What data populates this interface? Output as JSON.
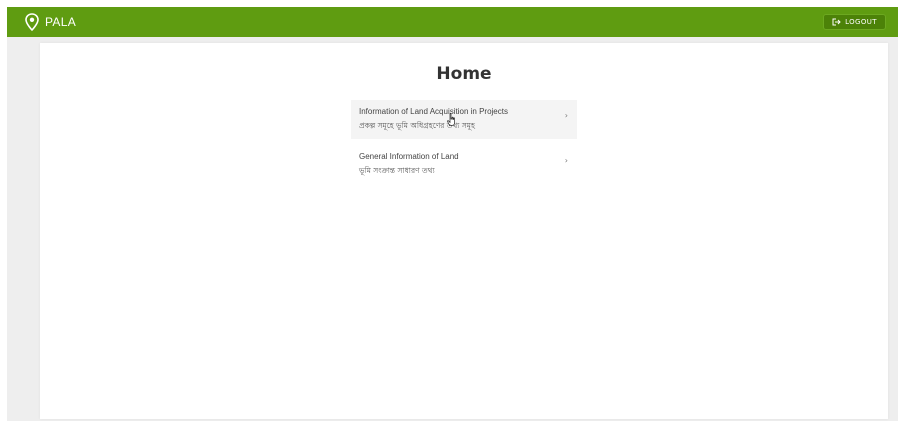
{
  "app": {
    "name": "PALA"
  },
  "header": {
    "logout_label": "LOGOUT"
  },
  "main": {
    "title": "Home",
    "items": [
      {
        "label_en": "Information of Land Acquisition in Projects",
        "label_bn": "প্রকল্প সমূহে ভূমি অধিগ্রহণের তথ্য সমূহ",
        "chevron": "›"
      },
      {
        "label_en": "General Information of Land",
        "label_bn": "ভূমি সংক্রান্ত সাধারণ তথ্য",
        "chevron": "›"
      }
    ]
  },
  "colors": {
    "topbar": "#5f9c11",
    "logout_button": "#4c8208",
    "background": "#eeeeee",
    "panel": "#ffffff"
  },
  "icons": {
    "brand": "location-pin-icon",
    "logout": "logout-icon",
    "item_arrow": "chevron-right-icon",
    "pointer": "hand-cursor-icon"
  }
}
